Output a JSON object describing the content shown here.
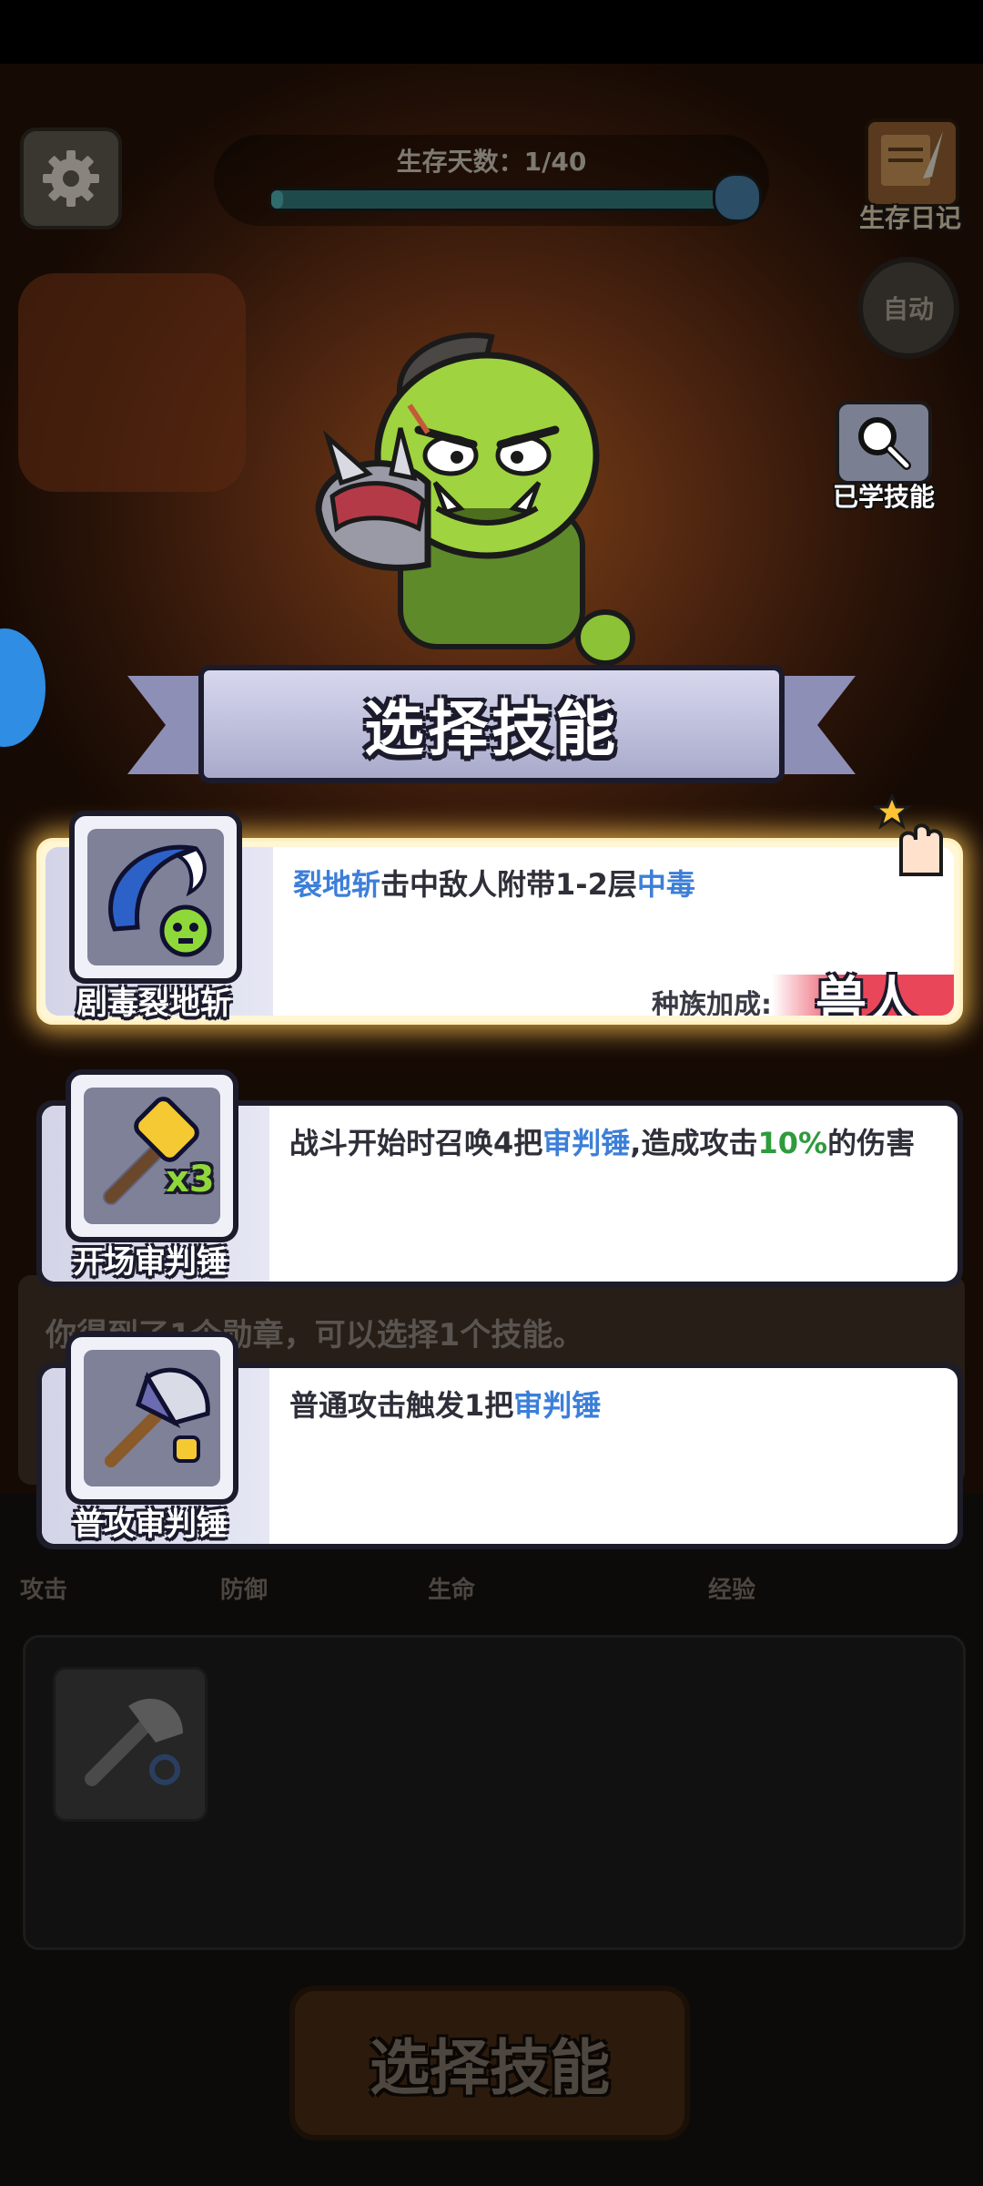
{
  "hud": {
    "survival_label": "生存天数：1/40",
    "survival_progress": 0.025,
    "diary_label": "生存日记",
    "auto_label": "自动",
    "learned_label": "已学技能"
  },
  "dialog": {
    "title": "选择技能",
    "cards": [
      {
        "name": "剧毒裂地斩",
        "desc_parts": [
          "裂地斩",
          "击中敌人附带1-2层",
          "中毒"
        ],
        "race_label": "种族加成:",
        "race_value": "兽人",
        "icon": "poison-slash-icon",
        "selected": true
      },
      {
        "name": "开场审判锤",
        "desc_parts": [
          "战斗开始时召唤4把",
          "审判锤",
          ",造成攻击",
          "10%",
          "的伤害"
        ],
        "badge": "x3",
        "icon": "golden-hammer-icon",
        "selected": false
      },
      {
        "name": "普攻审判锤",
        "desc_parts": [
          "普通攻击触发1把",
          "审判锤"
        ],
        "icon": "axe-hammer-icon",
        "selected": false
      }
    ]
  },
  "background": {
    "hint_text": "你得到了1个勋章，可以选择1个技能。",
    "stats": [
      "攻击",
      "防御",
      "生命",
      "经验"
    ],
    "select_button": "选择技能"
  },
  "colors": {
    "highlight_blue": "#3c7fd9",
    "highlight_green": "#2e9b3c",
    "race_red": "#e9465a",
    "glow": "#ffc454"
  }
}
